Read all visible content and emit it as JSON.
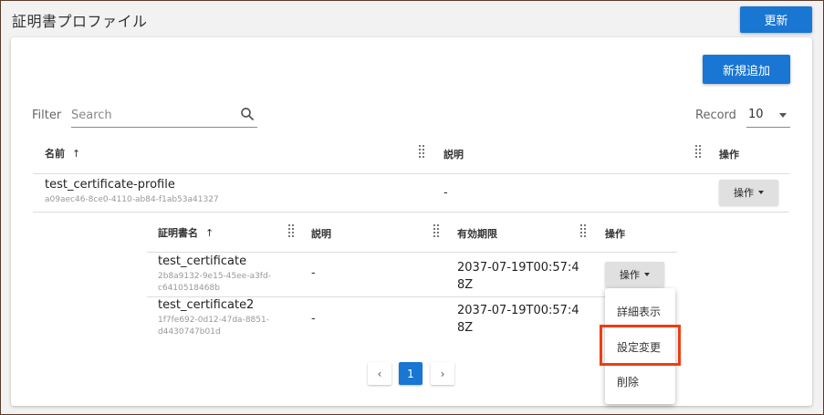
{
  "header": {
    "title": "証明書プロファイル",
    "refresh_label": "更新"
  },
  "toolbar": {
    "add_label": "新規追加",
    "filter_label": "Filter",
    "search_placeholder": "Search",
    "record_label": "Record",
    "record_value": "10"
  },
  "outer_table": {
    "columns": [
      "名前",
      "説明",
      "操作"
    ],
    "rows": [
      {
        "name": "test_certificate-profile",
        "id": "a09aec46-8ce0-4110-ab84-f1ab53a41327",
        "description": "-",
        "action_label": "操作"
      }
    ]
  },
  "inner_table": {
    "columns": [
      "証明書名",
      "説明",
      "有効期限",
      "操作"
    ],
    "rows": [
      {
        "name": "test_certificate",
        "id_line1": "2b8a9132-9e15-45ee-a3fd-",
        "id_line2": "c6410518468b",
        "description": "-",
        "expiry_line1": "2037-07-19T00:57:4",
        "expiry_line2": "8Z",
        "action_label": "操作"
      },
      {
        "name": "test_certificate2",
        "id_line1": "1f7fe692-0d12-47da-8851-",
        "id_line2": "d4430747b01d",
        "description": "-",
        "expiry_line1": "2037-07-19T00:57:4",
        "expiry_line2": "8Z"
      }
    ]
  },
  "dropdown_menu": {
    "items": [
      "詳細表示",
      "設定変更",
      "削除"
    ],
    "highlighted": "設定変更"
  },
  "pagination": {
    "prev": "‹",
    "current": "1",
    "next": "›"
  },
  "colors": {
    "primary": "#1976d2",
    "highlight_border": "#f03c10"
  }
}
